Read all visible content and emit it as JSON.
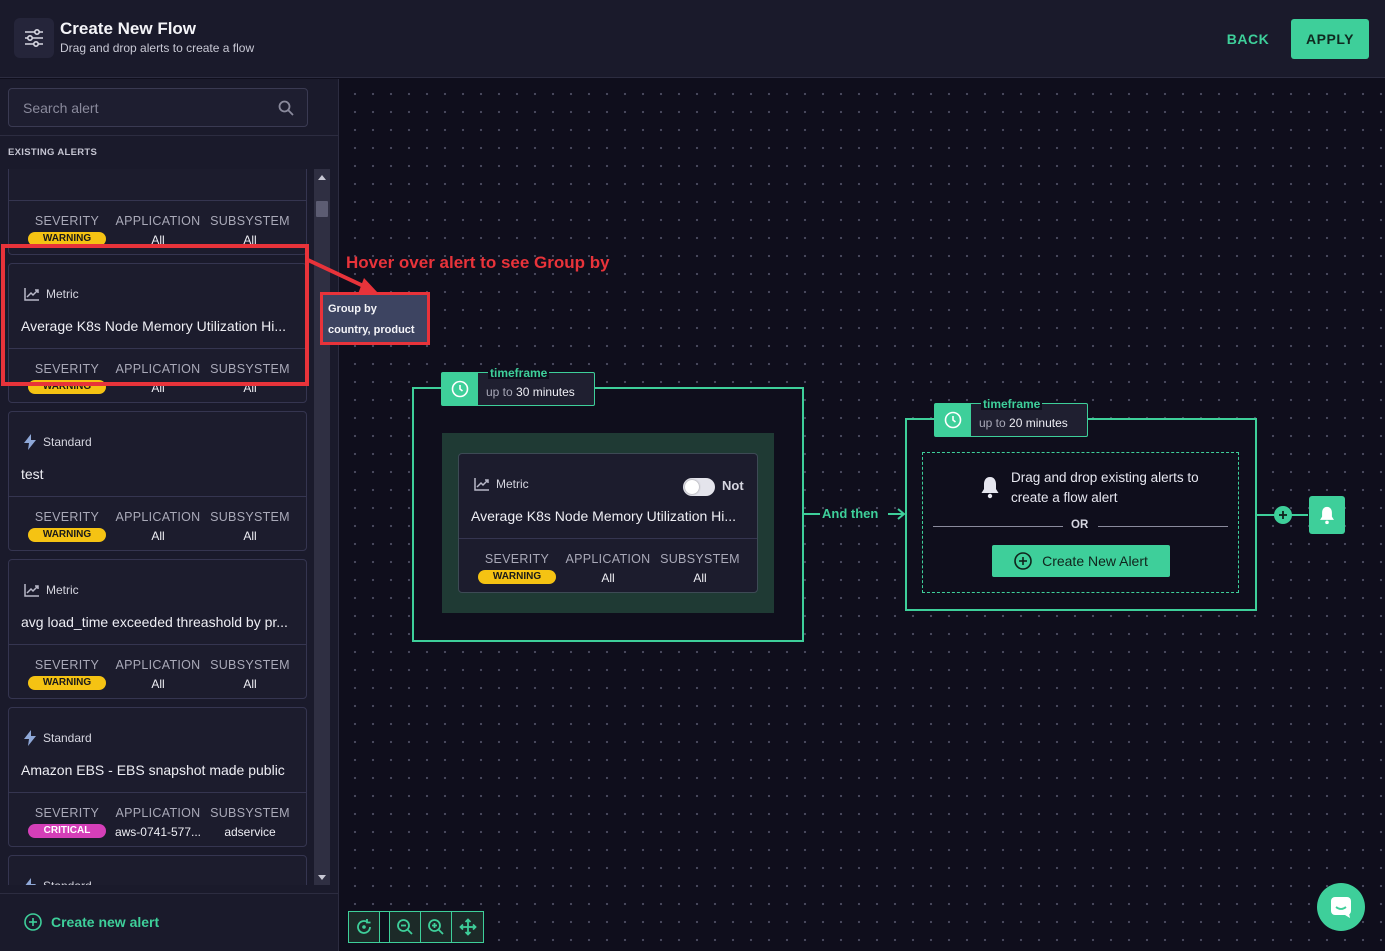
{
  "header": {
    "title": "Create New Flow",
    "subtitle": "Drag and drop alerts to create a flow",
    "back_label": "BACK",
    "apply_label": "APPLY"
  },
  "sidebar": {
    "search_placeholder": "Search alert",
    "section_label": "EXISTING ALERTS",
    "meta_labels": {
      "severity": "SEVERITY",
      "application": "APPLICATION",
      "subsystem": "SUBSYSTEM"
    },
    "alerts": [
      {
        "type": "",
        "name": "",
        "severity": "WARNING",
        "application": "All",
        "subsystem": "All"
      },
      {
        "type": "Metric",
        "name": "Average K8s Node Memory Utilization Hi...",
        "severity": "WARNING",
        "application": "All",
        "subsystem": "All"
      },
      {
        "type": "Standard",
        "name": "test",
        "severity": "WARNING",
        "application": "All",
        "subsystem": "All"
      },
      {
        "type": "Metric",
        "name": "avg load_time exceeded threashold by pr...",
        "severity": "WARNING",
        "application": "All",
        "subsystem": "All"
      },
      {
        "type": "Standard",
        "name": "Amazon EBS - EBS snapshot made public",
        "severity": "CRITICAL",
        "application": "aws-0741-577...",
        "subsystem": "adservice"
      },
      {
        "type": "Standard",
        "name": "",
        "severity": "",
        "application": "",
        "subsystem": ""
      }
    ],
    "create_label": "Create new alert"
  },
  "tooltip": {
    "title": "Group by",
    "text": "country, product"
  },
  "annotation": "Hover over alert to see Group by",
  "flow": {
    "group1": {
      "timeframe_label": "timeframe",
      "timeframe_prefix": "up to",
      "timeframe_value": "30 minutes",
      "alert": {
        "type": "Metric",
        "name": "Average K8s Node Memory Utilization Hi...",
        "toggle_label": "Not",
        "severity": "WARNING",
        "application": "All",
        "subsystem": "All"
      }
    },
    "connector_label": "And then",
    "group2": {
      "timeframe_label": "timeframe",
      "timeframe_prefix": "up to",
      "timeframe_value": "20 minutes",
      "drop_text": "Drag and drop existing alerts to create a flow alert",
      "or_label": "OR",
      "create_label": "Create New Alert"
    }
  },
  "colors": {
    "accent": "#3ecf9a",
    "warning": "#f5c313",
    "critical": "#d43fb8",
    "highlight": "#e8333a"
  }
}
